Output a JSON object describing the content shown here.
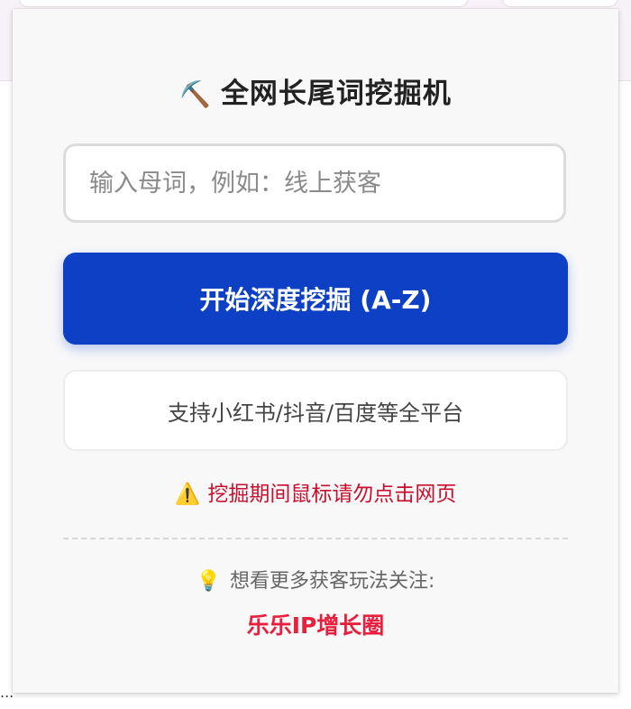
{
  "popup": {
    "title_icon": "⛏️",
    "title": "全网长尾词挖掘机",
    "search": {
      "placeholder": "输入母词，例如：线上获客",
      "value": ""
    },
    "start_button_label": "开始深度挖掘 (A-Z)",
    "platform_note": "支持小红书/抖音/百度等全平台",
    "warning": {
      "icon": "⚠️",
      "text": "挖掘期间鼠标请勿点击网页"
    },
    "follow": {
      "icon": "💡",
      "text": "想看更多获客玩法关注:"
    },
    "brand_link": "乐乐IP增长圈"
  },
  "page": {
    "ellipsis": "..."
  },
  "colors": {
    "accent": "#0d40c4",
    "warning_text": "#c8102e",
    "brand_text": "#e8203e"
  }
}
